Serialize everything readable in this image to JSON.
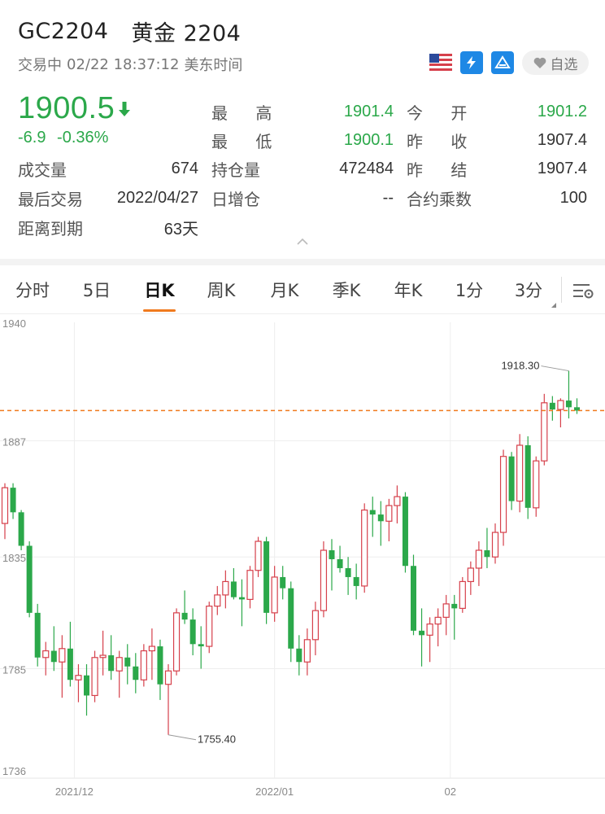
{
  "header": {
    "code": "GC2204",
    "name": "黄金 2204",
    "status": "交易中",
    "datetime": "02/22 18:37:12",
    "timezone": "美东时间",
    "favorite_label": "自选",
    "price": "1900.5",
    "change": "-6.9",
    "change_pct": "-0.36%",
    "colors": {
      "down": "#2ba84a",
      "up": "#d6404b",
      "accent": "#f07a1e"
    },
    "badges": [
      "us-flag-icon",
      "lightning-icon",
      "exchange-icon"
    ]
  },
  "stats": {
    "high_label": "最 高",
    "high": "1901.4",
    "open_label": "今 开",
    "open": "1901.2",
    "low_label": "最 低",
    "low": "1900.1",
    "prev_close_label": "昨 收",
    "prev_close": "1907.4",
    "volume_label": "成交量",
    "volume": "674",
    "open_interest_label": "持仓量",
    "open_interest": "472484",
    "prev_settle_label": "昨 结",
    "prev_settle": "1907.4",
    "last_trade_label": "最后交易",
    "last_trade": "2022/04/27",
    "oi_change_label": "日增仓",
    "oi_change": "--",
    "multiplier_label": "合约乘数",
    "multiplier": "100",
    "expiry_label": "距离到期",
    "expiry": "63天"
  },
  "tabs": [
    {
      "label": "分时"
    },
    {
      "label": "5日"
    },
    {
      "label": "日K"
    },
    {
      "label": "周K"
    },
    {
      "label": "月K"
    },
    {
      "label": "季K"
    },
    {
      "label": "年K"
    },
    {
      "label": "1分"
    },
    {
      "label": "3分"
    }
  ],
  "active_tab": "日K",
  "chart_data": {
    "type": "candlestick",
    "ylim": [
      1736,
      1940
    ],
    "yticks": [
      "1940",
      "1887",
      "1835",
      "1785",
      "1736"
    ],
    "xticks": [
      {
        "label": "2021/12",
        "index": 8.5
      },
      {
        "label": "2022/01",
        "index": 33
      },
      {
        "label": "02",
        "index": 54.5
      }
    ],
    "current_price": 1900.5,
    "high_annotation": {
      "label": "1918.30",
      "index": 69,
      "value": 1918.3
    },
    "low_annotation": {
      "label": "1755.40",
      "index": 20,
      "value": 1755.4
    },
    "candles": [
      [
        1850,
        1868,
        1843,
        1866
      ],
      [
        1866,
        1868,
        1852,
        1855
      ],
      [
        1855,
        1856,
        1838,
        1840
      ],
      [
        1840,
        1842,
        1808,
        1810
      ],
      [
        1810,
        1814,
        1786,
        1790
      ],
      [
        1790,
        1797,
        1782,
        1793
      ],
      [
        1793,
        1804,
        1784,
        1788
      ],
      [
        1788,
        1800,
        1772,
        1794
      ],
      [
        1794,
        1806,
        1777,
        1780
      ],
      [
        1780,
        1787,
        1770,
        1782
      ],
      [
        1782,
        1787,
        1764,
        1773
      ],
      [
        1773,
        1793,
        1770,
        1790
      ],
      [
        1790,
        1802,
        1782,
        1791
      ],
      [
        1791,
        1800,
        1780,
        1784
      ],
      [
        1784,
        1793,
        1772,
        1790
      ],
      [
        1790,
        1796,
        1778,
        1786
      ],
      [
        1786,
        1792,
        1774,
        1780
      ],
      [
        1780,
        1796,
        1777,
        1793
      ],
      [
        1793,
        1803,
        1780,
        1795
      ],
      [
        1795,
        1798,
        1771,
        1778
      ],
      [
        1778,
        1787,
        1755.4,
        1784
      ],
      [
        1784,
        1812,
        1782,
        1810
      ],
      [
        1810,
        1820,
        1805,
        1807
      ],
      [
        1807,
        1812,
        1791,
        1796
      ],
      [
        1796,
        1804,
        1785,
        1795
      ],
      [
        1795,
        1815,
        1792,
        1813
      ],
      [
        1813,
        1822,
        1809,
        1818
      ],
      [
        1818,
        1829,
        1812,
        1824
      ],
      [
        1824,
        1830,
        1816,
        1817
      ],
      [
        1817,
        1825,
        1804,
        1816
      ],
      [
        1816,
        1831,
        1812,
        1829
      ],
      [
        1829,
        1844,
        1826,
        1842
      ],
      [
        1842,
        1844,
        1805,
        1810
      ],
      [
        1810,
        1831,
        1806,
        1826
      ],
      [
        1826,
        1831,
        1816,
        1821
      ],
      [
        1821,
        1824,
        1788,
        1794
      ],
      [
        1794,
        1800,
        1782,
        1788
      ],
      [
        1788,
        1803,
        1782,
        1798
      ],
      [
        1798,
        1815,
        1791,
        1811
      ],
      [
        1811,
        1842,
        1808,
        1838
      ],
      [
        1838,
        1843,
        1820,
        1834
      ],
      [
        1834,
        1840,
        1828,
        1830
      ],
      [
        1830,
        1835,
        1818,
        1826
      ],
      [
        1826,
        1832,
        1816,
        1822
      ],
      [
        1822,
        1859,
        1819,
        1856
      ],
      [
        1856,
        1862,
        1844,
        1854
      ],
      [
        1854,
        1860,
        1840,
        1851
      ],
      [
        1851,
        1861,
        1842,
        1858
      ],
      [
        1858,
        1867,
        1850,
        1862
      ],
      [
        1862,
        1864,
        1828,
        1831
      ],
      [
        1831,
        1836,
        1800,
        1802
      ],
      [
        1802,
        1812,
        1786,
        1800
      ],
      [
        1800,
        1808,
        1788,
        1805
      ],
      [
        1805,
        1812,
        1795,
        1808
      ],
      [
        1808,
        1818,
        1800,
        1814
      ],
      [
        1814,
        1818,
        1798,
        1812
      ],
      [
        1812,
        1826,
        1810,
        1824
      ],
      [
        1824,
        1833,
        1818,
        1830
      ],
      [
        1830,
        1842,
        1822,
        1838
      ],
      [
        1838,
        1848,
        1830,
        1835
      ],
      [
        1835,
        1850,
        1832,
        1846
      ],
      [
        1846,
        1883,
        1840,
        1880
      ],
      [
        1880,
        1882,
        1856,
        1860
      ],
      [
        1860,
        1890,
        1855,
        1885
      ],
      [
        1885,
        1889,
        1852,
        1857
      ],
      [
        1857,
        1880,
        1853,
        1878
      ],
      [
        1878,
        1908,
        1876,
        1904
      ],
      [
        1904,
        1907,
        1896,
        1901
      ],
      [
        1901,
        1906,
        1893,
        1905
      ],
      [
        1905,
        1918.3,
        1897,
        1902
      ],
      [
        1902,
        1906,
        1899,
        1900.5
      ]
    ]
  }
}
